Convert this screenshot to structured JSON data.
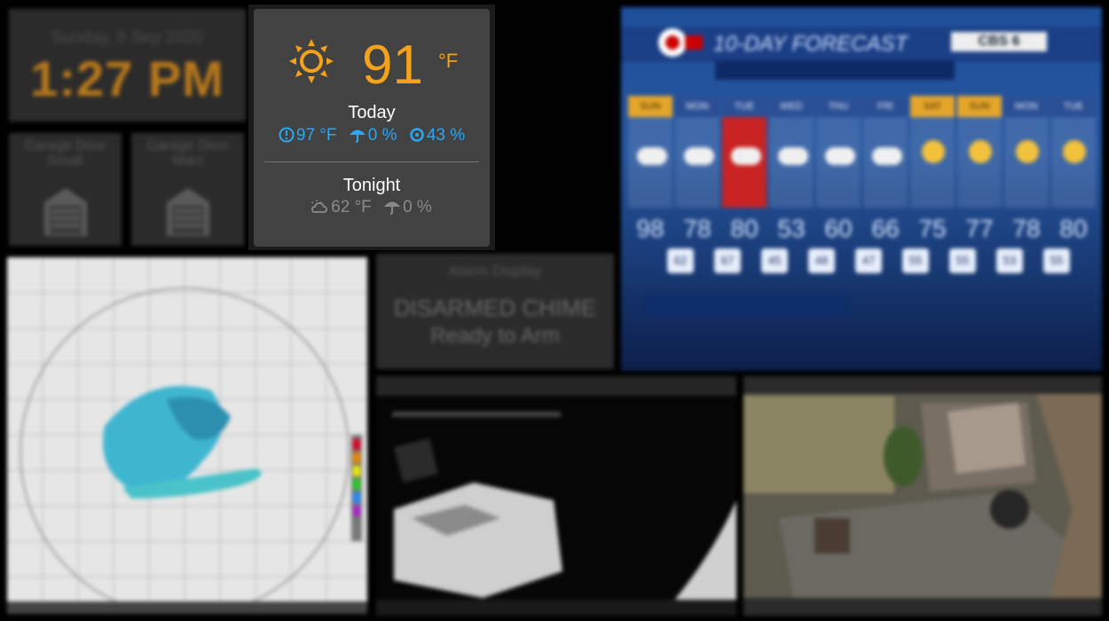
{
  "clock": {
    "date": "Sunday, 6 Sep 2020",
    "time": "1:27 PM"
  },
  "garage": [
    {
      "label": "Garage Door Small",
      "icon": "garage-door-icon"
    },
    {
      "label": "Garage Door Main",
      "icon": "garage-door-icon"
    }
  ],
  "weather": {
    "icon": "sun-icon",
    "temp": "91",
    "unit": "°F",
    "today_label": "Today",
    "today": {
      "feels_like": "97 °F",
      "precip": "0 %",
      "humidity": "43 %"
    },
    "tonight_label": "Tonight",
    "tonight": {
      "low": "62 °F",
      "precip": "0 %"
    },
    "colors": {
      "accent": "#f3a21b",
      "info": "#2aa7f5"
    }
  },
  "forecast": {
    "title": "10-DAY FORECAST",
    "logo": "CBS 6",
    "days": [
      "SUN",
      "MON",
      "TUE",
      "WED",
      "THU",
      "FRI",
      "SAT",
      "SUN",
      "MON",
      "TUE"
    ],
    "highs": [
      "98",
      "78",
      "80",
      "53",
      "60",
      "66",
      "75",
      "77",
      "78",
      "80"
    ],
    "lows": [
      "62",
      "67",
      "45",
      "48",
      "47",
      "55",
      "55",
      "53",
      "55",
      ""
    ]
  },
  "alarm": {
    "title": "Alarm Display",
    "status": "DISARMED CHIME",
    "substatus": "Ready to Arm"
  }
}
